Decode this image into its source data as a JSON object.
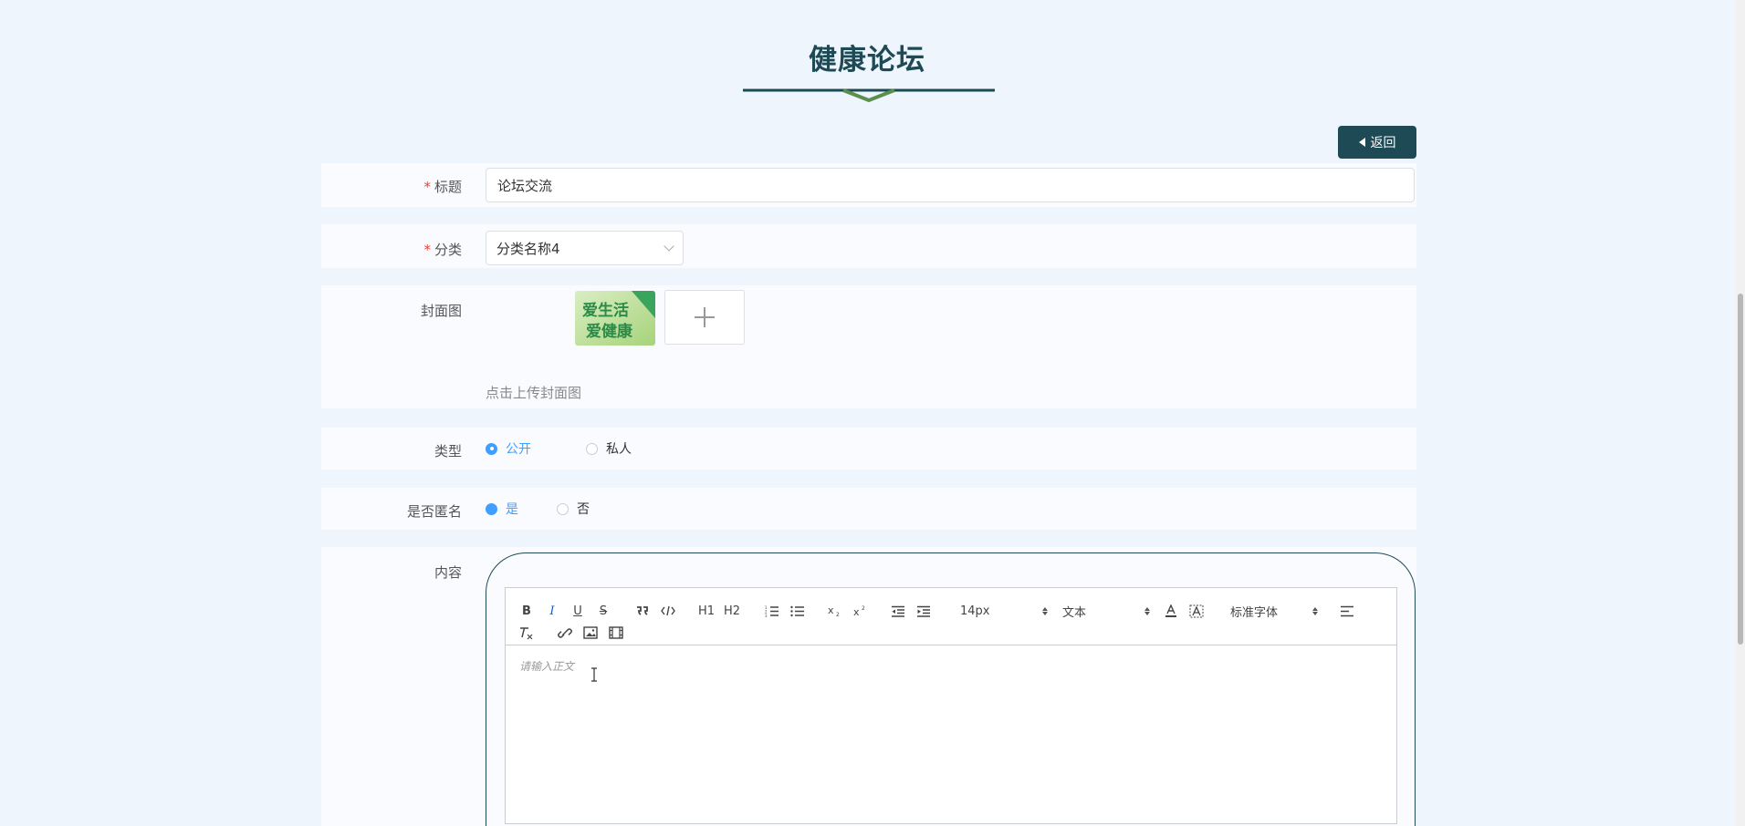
{
  "page": {
    "title": "健康论坛",
    "back_label": "返回"
  },
  "form": {
    "title_field": {
      "label": "标题",
      "required": "*",
      "value": "论坛交流"
    },
    "category_field": {
      "label": "分类",
      "required": "*",
      "value": "分类名称4"
    },
    "cover_field": {
      "label": "封面图",
      "hint": "点击上传封面图",
      "thumb_text_line1": "爱生活",
      "thumb_text_line2": "爱健康"
    },
    "type_field": {
      "label": "类型",
      "options": [
        "公开",
        "私人"
      ],
      "selected": "公开"
    },
    "anon_field": {
      "label": "是否匿名",
      "options": [
        "是",
        "否"
      ],
      "selected": "是"
    },
    "content_field": {
      "label": "内容",
      "placeholder": "请输入正文",
      "toolbar": {
        "bold": "B",
        "italic": "I",
        "underline": "U",
        "strike": "S",
        "h1": "H1",
        "h2": "H2",
        "sub": "x2",
        "sup": "x2",
        "size": "14px",
        "header": "文本",
        "font": "标准字体",
        "clean": "Tx"
      }
    }
  },
  "colors": {
    "primary": "#1d4a55",
    "accent_green": "#5a8f4e",
    "radio_blue": "#409eff",
    "required_red": "#e7403d",
    "background": "#eff5fd"
  }
}
